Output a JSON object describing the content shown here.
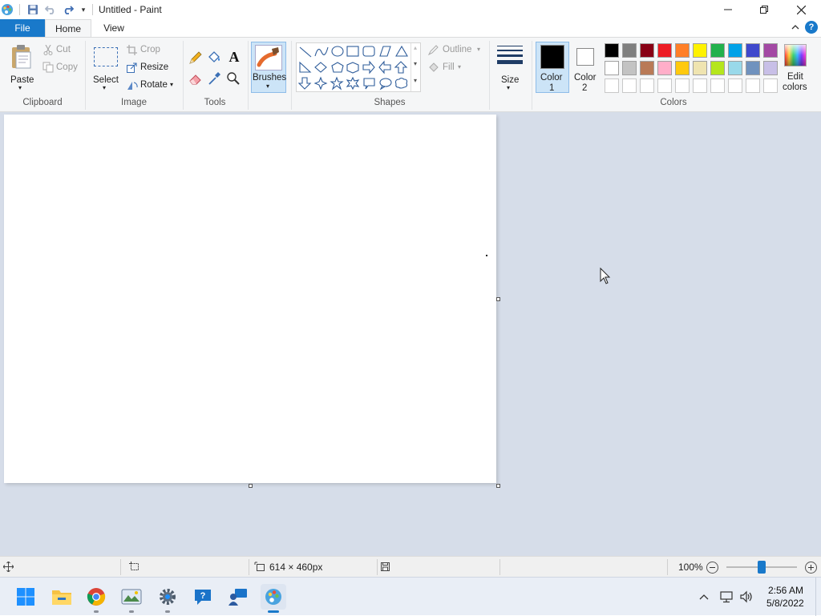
{
  "window": {
    "title": "Untitled - Paint"
  },
  "tabs": [
    {
      "label": "File"
    },
    {
      "label": "Home"
    },
    {
      "label": "View"
    }
  ],
  "help_label": "?",
  "ribbon": {
    "clipboard": {
      "paste": "Paste",
      "cut": "Cut",
      "copy": "Copy",
      "group": "Clipboard"
    },
    "image": {
      "select": "Select",
      "crop": "Crop",
      "resize": "Resize",
      "rotate": "Rotate",
      "group": "Image"
    },
    "tools": {
      "group": "Tools",
      "text_glyph": "A"
    },
    "brushes": {
      "label": "Brushes"
    },
    "shapes": {
      "outline": "Outline",
      "fill": "Fill",
      "group": "Shapes"
    },
    "size": {
      "label": "Size"
    },
    "colors": {
      "color1_line1": "Color",
      "color1_line2": "1",
      "color2_line1": "Color",
      "color2_line2": "2",
      "edit_line1": "Edit",
      "edit_line2": "colors",
      "group": "Colors",
      "color1_value": "#000000",
      "color2_value": "#ffffff",
      "row1": [
        "#000000",
        "#7f7f7f",
        "#880015",
        "#ed1c24",
        "#ff7f27",
        "#fff200",
        "#22b14c",
        "#00a2e8",
        "#3f48cc",
        "#a349a4"
      ],
      "row2": [
        "#ffffff",
        "#c3c3c3",
        "#b97a57",
        "#ffaec9",
        "#ffc90e",
        "#efe4b0",
        "#b5e61d",
        "#99d9ea",
        "#7092be",
        "#c8bfe7"
      ]
    }
  },
  "statusbar": {
    "dimensions": "614 × 460px",
    "zoom": "100%",
    "zoom_level": 0.5
  },
  "taskbar": {
    "time": "2:56 AM",
    "date": "5/8/2022"
  },
  "accent": "#1979ca",
  "workspace_bg": "#d6dde9"
}
